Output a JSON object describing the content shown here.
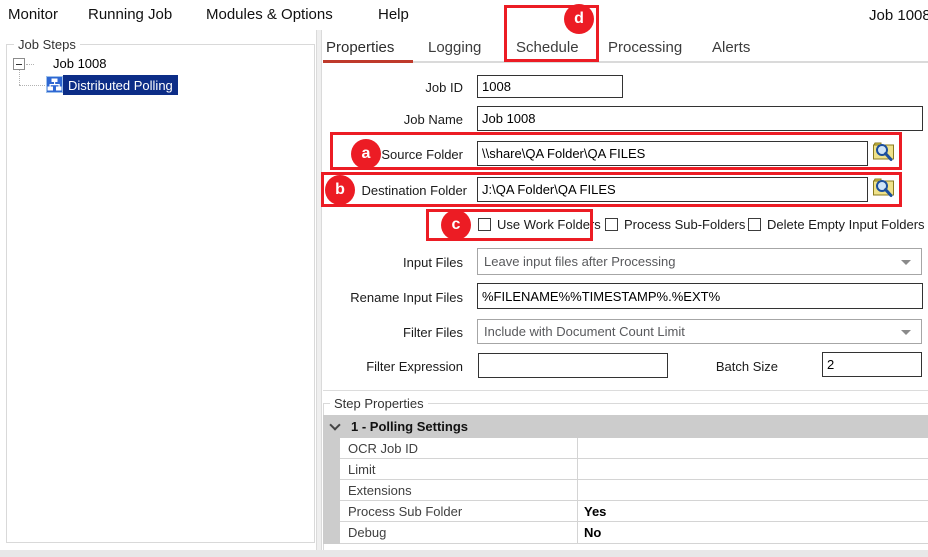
{
  "window": {
    "job_label": "Job 1008"
  },
  "menu": {
    "items": [
      {
        "label": "Monitor"
      },
      {
        "label": "Running Job"
      },
      {
        "label": "Modules & Options"
      },
      {
        "label": "Help"
      }
    ]
  },
  "job_steps": {
    "title": "Job Steps",
    "root_node": "Job 1008",
    "selected_node": "Distributed Polling"
  },
  "tabs": [
    {
      "label": "Properties",
      "active": true
    },
    {
      "label": "Logging",
      "active": false
    },
    {
      "label": "Schedule",
      "active": false
    },
    {
      "label": "Processing",
      "active": false
    },
    {
      "label": "Alerts",
      "active": false
    }
  ],
  "form": {
    "job_id": {
      "label": "Job ID",
      "value": "1008"
    },
    "job_name": {
      "label": "Job Name",
      "value": "Job 1008"
    },
    "source_folder": {
      "label": "Source Folder",
      "value": "\\\\share\\QA Folder\\QA FILES"
    },
    "destination_folder": {
      "label": "Destination Folder",
      "value": "J:\\QA Folder\\QA FILES"
    },
    "checkboxes": [
      {
        "label": "Use Work Folders",
        "checked": false
      },
      {
        "label": "Process Sub-Folders",
        "checked": false
      },
      {
        "label": "Delete Empty Input Folders",
        "checked": false
      }
    ],
    "input_files": {
      "label": "Input Files",
      "value": "Leave input files after Processing"
    },
    "rename_input_files": {
      "label": "Rename Input Files",
      "value": "%FILENAME%%TIMESTAMP%.%EXT%"
    },
    "filter_files": {
      "label": "Filter Files",
      "value": "Include with Document Count Limit"
    },
    "filter_expression": {
      "label": "Filter Expression",
      "value": ""
    },
    "batch_size": {
      "label": "Batch Size",
      "value": "2"
    }
  },
  "step_properties": {
    "title": "Step Properties",
    "group_header": "1 - Polling Settings",
    "rows": [
      {
        "name": "OCR Job ID",
        "value": ""
      },
      {
        "name": "Limit",
        "value": ""
      },
      {
        "name": "Extensions",
        "value": ""
      },
      {
        "name": "Process Sub Folder",
        "value": "Yes"
      },
      {
        "name": "Debug",
        "value": "No"
      }
    ]
  },
  "annotations": {
    "a": {
      "letter": "a",
      "target": "source-folder"
    },
    "b": {
      "letter": "b",
      "target": "destination-folder"
    },
    "c": {
      "letter": "c",
      "target": "use-work-folders"
    },
    "d": {
      "letter": "d",
      "target": "schedule-tab"
    }
  },
  "colors": {
    "annotation_red": "#ec1c24",
    "active_tab_underline": "#bf3a2b",
    "tree_selection": "#0c2d87"
  }
}
